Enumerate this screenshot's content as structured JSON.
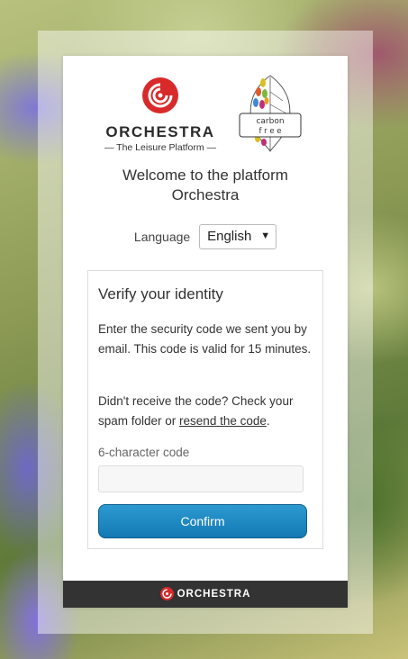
{
  "brand": {
    "name": "ORCHESTRA",
    "tagline": "— The Leisure Platform —",
    "primary_color": "#d82a2a",
    "carbon_line1": "carbon",
    "carbon_line2": "f r e e"
  },
  "welcome": {
    "line1": "Welcome to the platform",
    "line2": "Orchestra"
  },
  "language": {
    "label": "Language",
    "selected": "English"
  },
  "verify": {
    "title": "Verify your identity",
    "instructions": "Enter the security code we sent you by email. This code is valid for 15 minutes.",
    "resend_prefix": "Didn't receive the code? Check your spam folder or ",
    "resend_link": "resend the code",
    "resend_suffix": ".",
    "code_label": "6-character code",
    "code_value": "",
    "confirm_label": "Confirm",
    "confirm_color": "#1a85c0"
  },
  "footer": {
    "brand": "ORCHESTRA"
  }
}
